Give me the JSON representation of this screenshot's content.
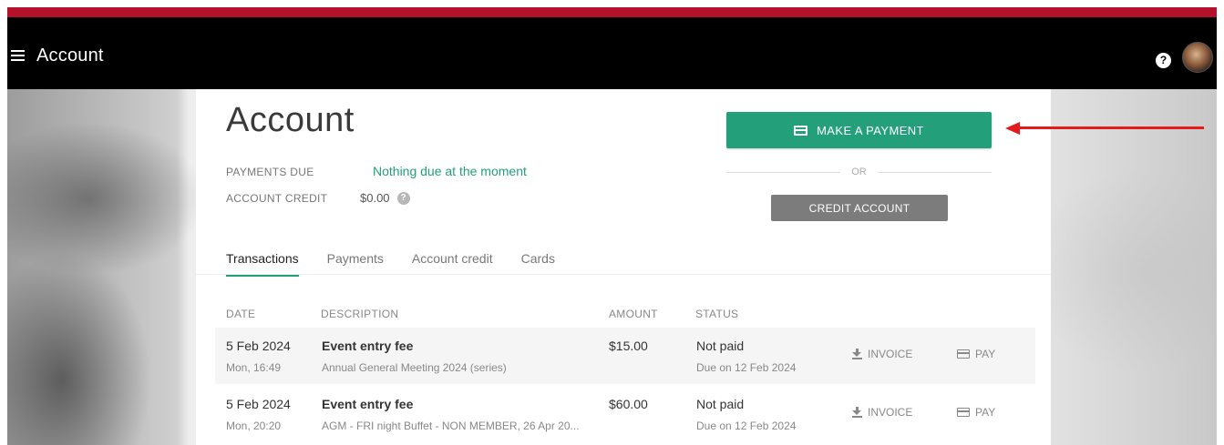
{
  "topbar": {
    "title": "Account",
    "menu_icon": "hamburger-menu-icon",
    "help_icon": "help-icon",
    "help_glyph": "?",
    "avatar": "user-avatar",
    "accent_color": "#b3122a"
  },
  "account": {
    "title": "Account",
    "payments_due_label": "PAYMENTS DUE",
    "payments_due_value": "Nothing due at the moment",
    "account_credit_label": "ACCOUNT CREDIT",
    "account_credit_value": "$0.00",
    "info_glyph": "?",
    "make_payment_label": "MAKE A PAYMENT",
    "or_label": "OR",
    "credit_account_label": "CREDIT ACCOUNT",
    "primary_color": "#23a079"
  },
  "tabs": [
    {
      "label": "Transactions",
      "active": true
    },
    {
      "label": "Payments",
      "active": false
    },
    {
      "label": "Account credit",
      "active": false
    },
    {
      "label": "Cards",
      "active": false
    }
  ],
  "table": {
    "columns": [
      "DATE",
      "DESCRIPTION",
      "AMOUNT",
      "STATUS"
    ],
    "rows": [
      {
        "date": "5 Feb 2024",
        "time": "Mon, 16:49",
        "title": "Event entry fee",
        "subtitle": "Annual General Meeting 2024 (series)",
        "amount": "$15.00",
        "status": "Not paid",
        "due": "Due on 12 Feb 2024",
        "invoice_label": "INVOICE",
        "pay_label": "PAY"
      },
      {
        "date": "5 Feb 2024",
        "time": "Mon, 20:20",
        "title": "Event entry fee",
        "subtitle": "AGM - FRI night Buffet - NON MEMBER, 26 Apr 20...",
        "amount": "$60.00",
        "status": "Not paid",
        "due": "Due on 12 Feb 2024",
        "invoice_label": "INVOICE",
        "pay_label": "PAY"
      }
    ]
  },
  "annotation": {
    "arrow_color": "#e31b1b",
    "arrow_icon": "left-arrow-icon"
  }
}
